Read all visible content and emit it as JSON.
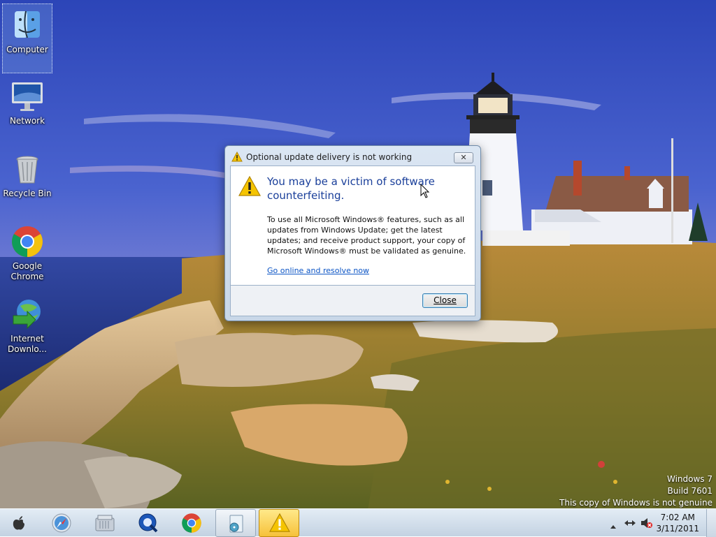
{
  "desktop": {
    "icons": [
      {
        "label": "Computer",
        "icon": "finder-icon"
      },
      {
        "label": "Network",
        "icon": "imac-monitor-icon"
      },
      {
        "label": "Recycle Bin",
        "icon": "trash-can-icon"
      },
      {
        "label": "Google\nChrome",
        "icon": "chrome-icon"
      },
      {
        "label": "Internet\nDownlo...",
        "icon": "internet-download-manager-icon"
      }
    ]
  },
  "dialog": {
    "title": "Optional update delivery is not working",
    "headline": "You may be a victim of software counterfeiting.",
    "body": "To use all Microsoft Windows® features, such as all updates from Windows Update; get the latest updates; and receive product support, your copy of Microsoft Windows® must be validated as genuine.",
    "link": "Go online and resolve now",
    "close_button": "Close",
    "close_x": "✕"
  },
  "watermark": {
    "line1": "Windows 7",
    "line2": "Build 7601",
    "line3": "This copy of Windows is not genuine"
  },
  "taskbar": {
    "buttons": [
      {
        "name": "apple-start-button",
        "icon": "apple-logo-icon"
      },
      {
        "name": "safari-button",
        "icon": "safari-compass-icon"
      },
      {
        "name": "file-explorer-button",
        "icon": "folder-library-icon"
      },
      {
        "name": "quicktime-button",
        "icon": "quicktime-icon"
      },
      {
        "name": "chrome-button",
        "icon": "chrome-icon"
      },
      {
        "name": "media-window-button",
        "icon": "media-document-icon"
      },
      {
        "name": "genuine-warning-button",
        "icon": "warning-triangle-icon"
      }
    ],
    "tray": {
      "icons": [
        "show-hidden-icons-arrow",
        "network-icon",
        "volume-muted-icon"
      ]
    },
    "clock": {
      "time": "7:02 AM",
      "date": "3/11/2011"
    }
  },
  "colors": {
    "headline_blue": "#1a3f9a",
    "link_blue": "#0b54c5",
    "warning_yellow": "#f5c400"
  }
}
